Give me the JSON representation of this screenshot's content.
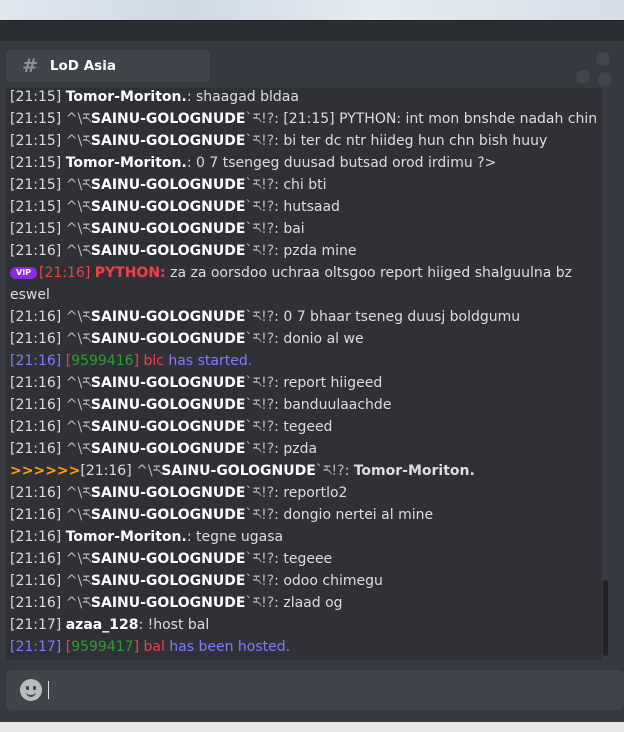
{
  "channel": {
    "icon": "hash-icon",
    "name": "LoD Asia"
  },
  "colors": {
    "timestamp": "#dcddde",
    "nick": "#ffffff",
    "vip": "#ed4245",
    "system_text": "#7d7dff",
    "game_id": "#2e9d2e",
    "highlight_arrows": "#ffa500"
  },
  "messages": [
    {
      "type": "chat",
      "ts": "[21:15]",
      "deco_left": "",
      "nick": "Tomor-Moriton.",
      "deco_right": "",
      "text": "shaagad bldaa"
    },
    {
      "type": "chat",
      "ts": "[21:15]",
      "deco_left": "^\\ར",
      "nick": "SAINU-GOLOGNUDE",
      "deco_right": "`ར!?",
      "text": "[21:15] PYTHON: int mon bnshde nadah chin"
    },
    {
      "type": "chat",
      "ts": "[21:15]",
      "deco_left": "^\\ར",
      "nick": "SAINU-GOLOGNUDE",
      "deco_right": "`ར!?",
      "text": "bi ter dc ntr hiideg hun chn bish huuy"
    },
    {
      "type": "chat",
      "ts": "[21:15]",
      "deco_left": "",
      "nick": "Tomor-Moriton.",
      "deco_right": "",
      "text": "0 7 tsengeg duusad butsad orod irdimu ?>"
    },
    {
      "type": "chat",
      "ts": "[21:15]",
      "deco_left": "^\\ར",
      "nick": "SAINU-GOLOGNUDE",
      "deco_right": "`ར!?",
      "text": "chi bti"
    },
    {
      "type": "chat",
      "ts": "[21:15]",
      "deco_left": "^\\ར",
      "nick": "SAINU-GOLOGNUDE",
      "deco_right": "`ར!?",
      "text": "hutsaad"
    },
    {
      "type": "chat",
      "ts": "[21:15]",
      "deco_left": "^\\ར",
      "nick": "SAINU-GOLOGNUDE",
      "deco_right": "`ར!?",
      "text": "bai"
    },
    {
      "type": "chat",
      "ts": "[21:16]",
      "deco_left": "^\\ར",
      "nick": "SAINU-GOLOGNUDE",
      "deco_right": "`ར!?",
      "text": "pzda mine"
    },
    {
      "type": "vip",
      "badge": "VIP",
      "ts": "[21:16]",
      "nick": "PYTHON:",
      "text": "za za oorsdoo uchraa oltsgoo report hiiged shalguulna bz eswel"
    },
    {
      "type": "chat",
      "ts": "[21:16]",
      "deco_left": "^\\ར",
      "nick": "SAINU-GOLOGNUDE",
      "deco_right": "`ར!?",
      "text": "0 7 bhaar tseneg duusj boldgumu"
    },
    {
      "type": "chat",
      "ts": "[21:16]",
      "deco_left": "^\\ར",
      "nick": "SAINU-GOLOGNUDE",
      "deco_right": "`ར!?",
      "text": "donio al we"
    },
    {
      "type": "system",
      "ts": "[21:16]",
      "open": "[",
      "game_id": "9599416",
      "close": "]",
      "game": "blc",
      "text": "has started."
    },
    {
      "type": "chat",
      "ts": "[21:16]",
      "deco_left": "^\\ར",
      "nick": "SAINU-GOLOGNUDE",
      "deco_right": "`ར!?",
      "text": "report hiigeed"
    },
    {
      "type": "chat",
      "ts": "[21:16]",
      "deco_left": "^\\ར",
      "nick": "SAINU-GOLOGNUDE",
      "deco_right": "`ར!?",
      "text": "banduulaachde"
    },
    {
      "type": "chat",
      "ts": "[21:16]",
      "deco_left": "^\\ར",
      "nick": "SAINU-GOLOGNUDE",
      "deco_right": "`ར!?",
      "text": "tegeed"
    },
    {
      "type": "chat",
      "ts": "[21:16]",
      "deco_left": "^\\ར",
      "nick": "SAINU-GOLOGNUDE",
      "deco_right": "`ར!?",
      "text": "pzda"
    },
    {
      "type": "highlight",
      "prefix": ">>>>>>",
      "ts": "[21:16]",
      "deco_left": "^\\ར",
      "nick": "SAINU-GOLOGNUDE",
      "deco_right": "`ར!?",
      "text": "Tomor-Moriton."
    },
    {
      "type": "chat",
      "ts": "[21:16]",
      "deco_left": "^\\ར",
      "nick": "SAINU-GOLOGNUDE",
      "deco_right": "`ར!?",
      "text": "reportlo2"
    },
    {
      "type": "chat",
      "ts": "[21:16]",
      "deco_left": "^\\ར",
      "nick": "SAINU-GOLOGNUDE",
      "deco_right": "`ར!?",
      "text": "dongio nertei al mine"
    },
    {
      "type": "chat",
      "ts": "[21:16]",
      "deco_left": "",
      "nick": "Tomor-Moriton.",
      "deco_right": "",
      "text": "tegne ugasa"
    },
    {
      "type": "chat",
      "ts": "[21:16]",
      "deco_left": "^\\ར",
      "nick": "SAINU-GOLOGNUDE",
      "deco_right": "`ར!?",
      "text": "tegeee"
    },
    {
      "type": "chat",
      "ts": "[21:16]",
      "deco_left": "^\\ར",
      "nick": "SAINU-GOLOGNUDE",
      "deco_right": "`ར!?",
      "text": "odoo chimegu"
    },
    {
      "type": "chat",
      "ts": "[21:16]",
      "deco_left": "^\\ར",
      "nick": "SAINU-GOLOGNUDE",
      "deco_right": "`ར!?",
      "text": "zlaad og"
    },
    {
      "type": "chat",
      "ts": "[21:17]",
      "deco_left": "",
      "nick": "azaa_128",
      "deco_right": "",
      "text": "!host bal"
    },
    {
      "type": "system",
      "ts": "[21:17]",
      "open": "[",
      "game_id": "9599417",
      "close": "]",
      "game": "bal",
      "text": "has been hosted."
    }
  ],
  "composer": {
    "emoji_icon": "emoji-icon",
    "value": ""
  }
}
